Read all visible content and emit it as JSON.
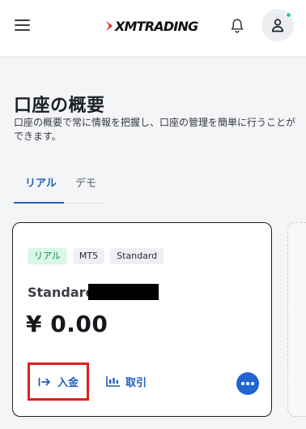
{
  "header": {
    "brand": "XMTRADING",
    "menu_icon": "hamburger-menu-icon",
    "bell_icon": "bell-icon",
    "user_icon": "user-icon",
    "status_color": "#2ecc8e"
  },
  "page": {
    "title": "口座の概要",
    "subtitle": "口座の概要で常に情報を把握し、口座の管理を簡単に行うことができます。"
  },
  "tabs": [
    {
      "label": "リアル",
      "active": true
    },
    {
      "label": "デモ",
      "active": false
    }
  ],
  "account_card": {
    "badges": [
      "リアル",
      "MT5",
      "Standard"
    ],
    "account_name": "Standard",
    "balance": "¥ 0.00",
    "deposit_label": "入金",
    "trade_label": "取引",
    "accent_color": "#2364d2",
    "highlight_color": "#e0201b"
  }
}
